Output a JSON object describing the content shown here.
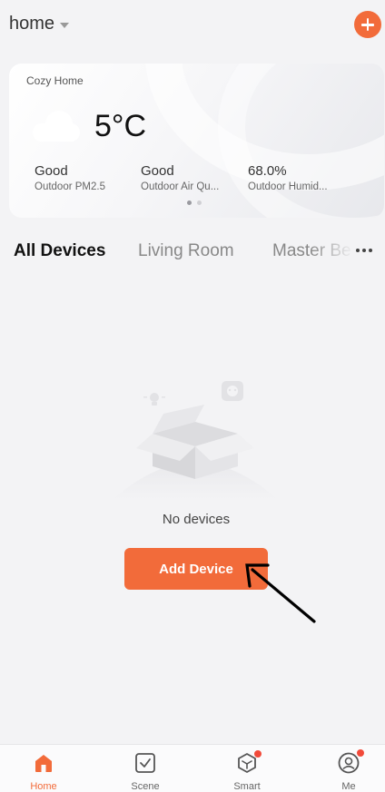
{
  "header": {
    "home_label": "home"
  },
  "weather": {
    "home_name": "Cozy Home",
    "temperature": "5°C",
    "metrics": [
      {
        "value": "Good",
        "label": "Outdoor PM2.5"
      },
      {
        "value": "Good",
        "label": "Outdoor Air Qu..."
      },
      {
        "value": "68.0%",
        "label": "Outdoor Humid..."
      }
    ]
  },
  "tabs": [
    "All Devices",
    "Living Room",
    "Master Be"
  ],
  "empty_state": {
    "text": "No devices",
    "button_label": "Add Device"
  },
  "bottom_nav": [
    {
      "label": "Home"
    },
    {
      "label": "Scene"
    },
    {
      "label": "Smart"
    },
    {
      "label": "Me"
    }
  ],
  "colors": {
    "accent": "#f26b3a",
    "badge": "#f24a3a",
    "background": "#f3f3f5"
  }
}
